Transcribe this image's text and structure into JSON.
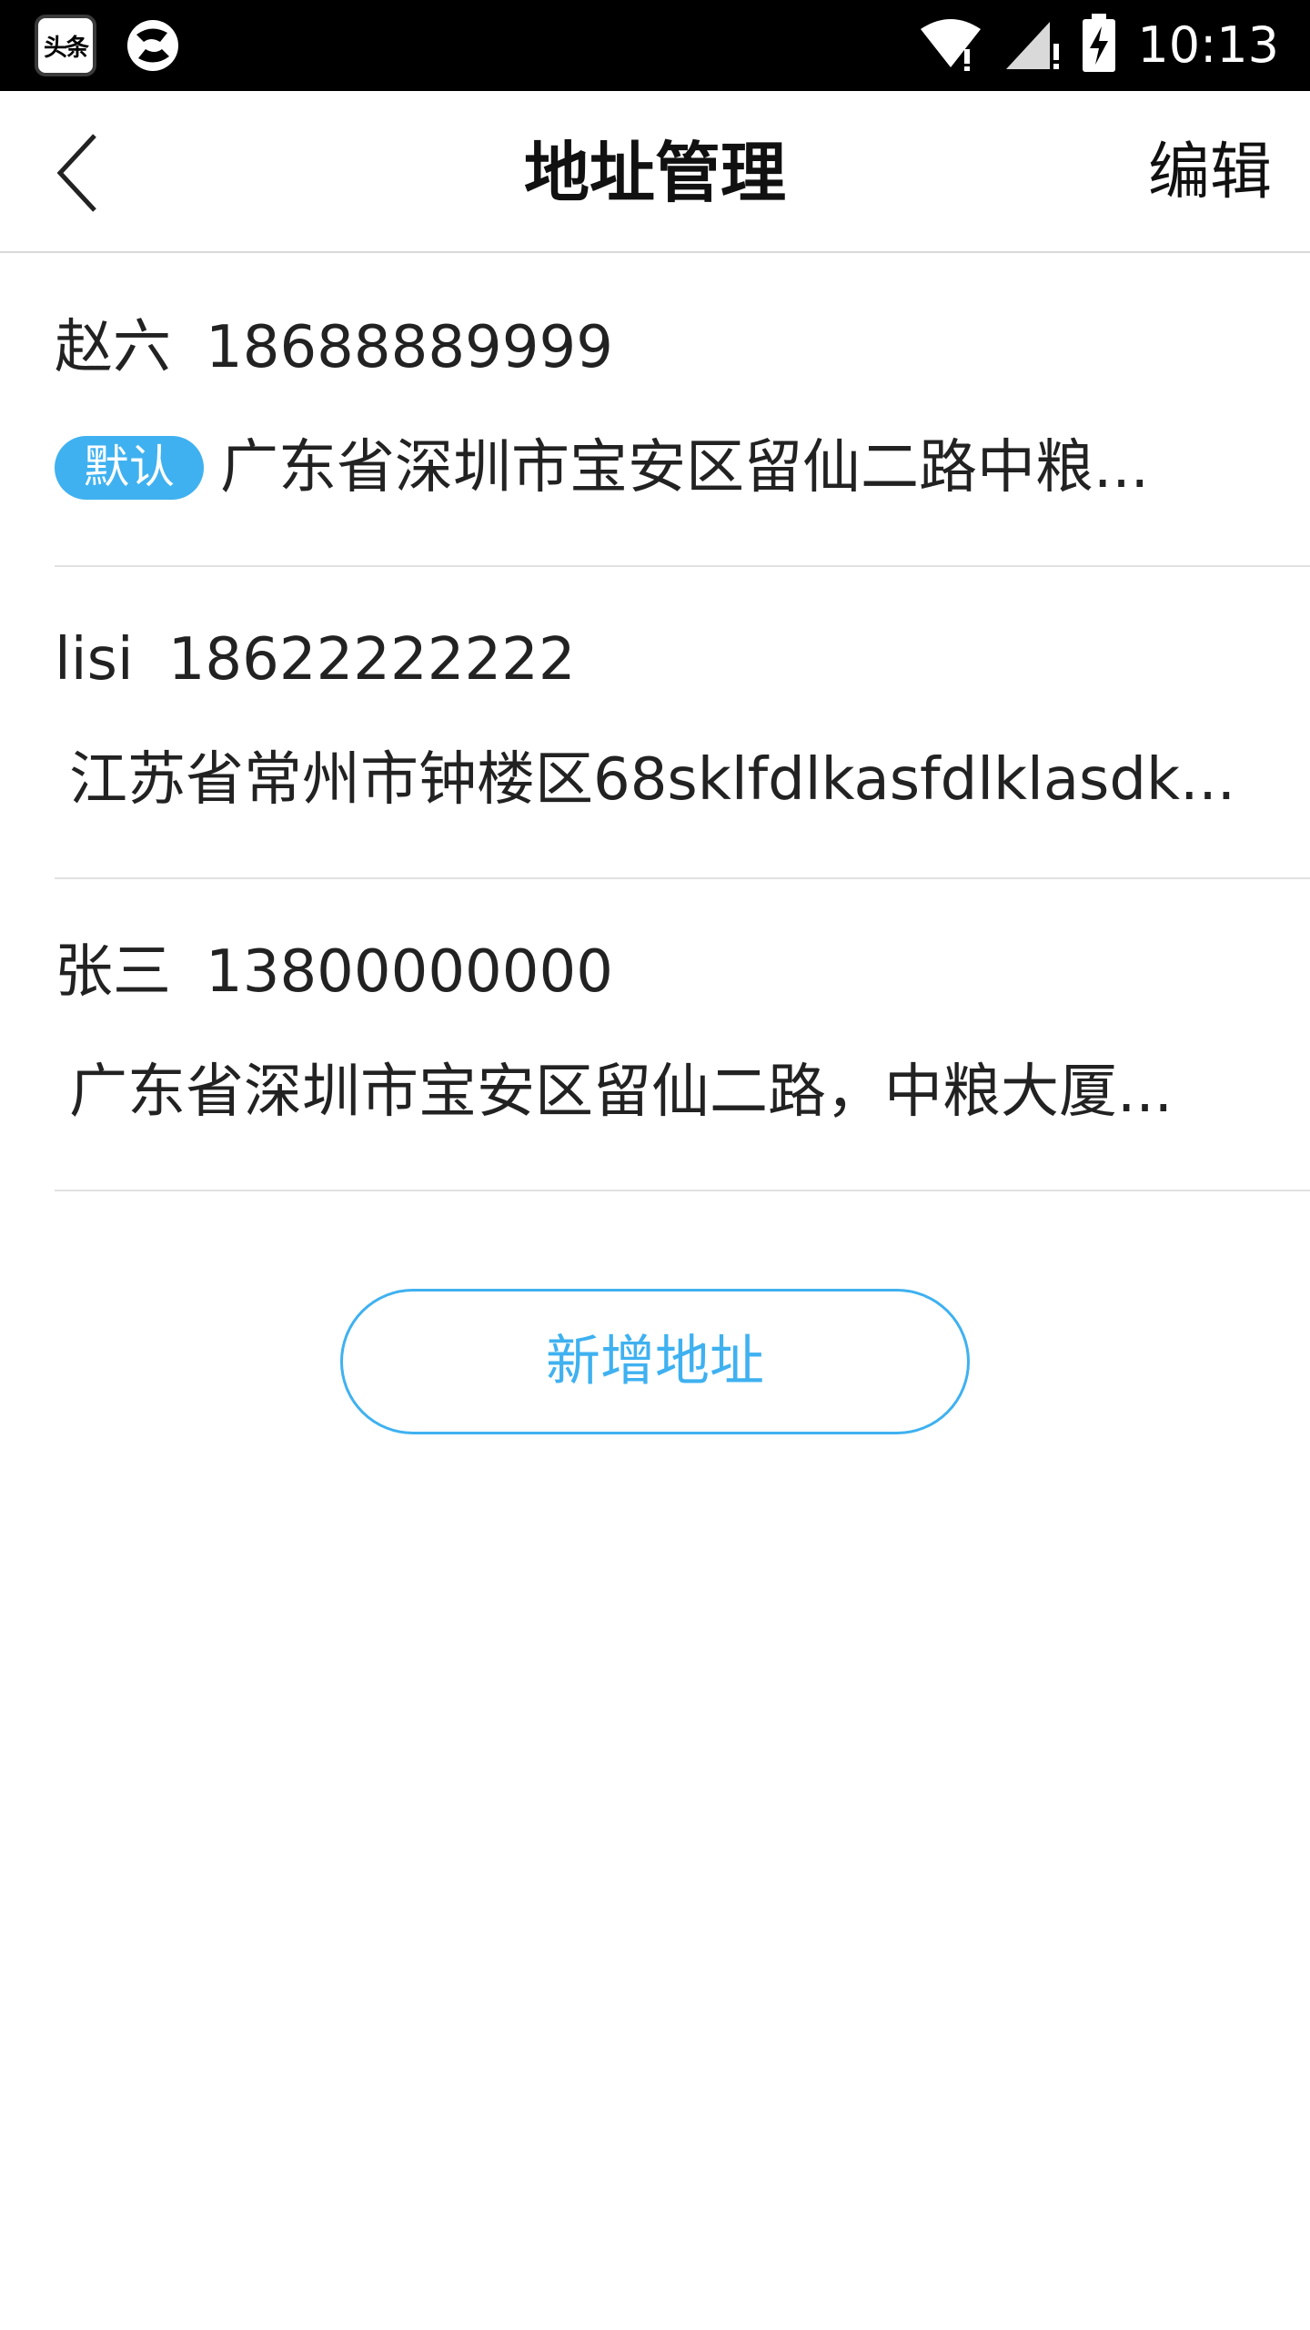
{
  "status_bar": {
    "news_app_label": "头条",
    "time": "10:13",
    "icons": [
      "news-app-icon",
      "sync-icon",
      "wifi-icon",
      "signal-icon",
      "battery-charging-icon"
    ]
  },
  "header": {
    "title": "地址管理",
    "edit_label": "编辑",
    "back_icon": "chevron-left-icon"
  },
  "addresses": [
    {
      "name": "赵六",
      "phone": "18688889999",
      "badge": "默认",
      "address": "广东省深圳市宝安区留仙二路中粮..."
    },
    {
      "name": "lisi",
      "phone": "18622222222",
      "address": "江苏省常州市钟楼区68sklfdlkasfdlklasdk..."
    },
    {
      "name": "张三",
      "phone": "13800000000",
      "address": "广东省深圳市宝安区留仙二路，中粮大厦..."
    }
  ],
  "add_button_label": "新增地址",
  "colors": {
    "accent": "#3fb1f0",
    "status_bar": "#000000",
    "divider": "#e1e1e1"
  }
}
